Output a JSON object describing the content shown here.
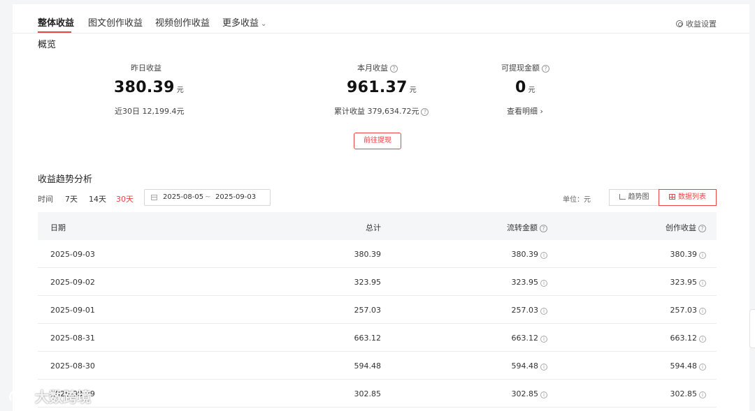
{
  "tabs": [
    {
      "label": "整体收益",
      "active": true
    },
    {
      "label": "图文创作收益",
      "active": false
    },
    {
      "label": "视频创作收益",
      "active": false
    },
    {
      "label": "更多收益",
      "active": false
    }
  ],
  "settings_label": "收益设置",
  "overview": {
    "title": "概览",
    "yesterday": {
      "label": "昨日收益",
      "value": "380.39",
      "unit": "元",
      "sub": "近30日 12,199.4元"
    },
    "month": {
      "label": "本月收益",
      "value": "961.37",
      "unit": "元",
      "sub": "累计收益 379,634.72元"
    },
    "withdrawable": {
      "label": "可提现金额",
      "value": "0",
      "unit": "元",
      "sub": "查看明细"
    },
    "withdraw_button": "前往提现"
  },
  "trend": {
    "title": "收益趋势分析",
    "time_label": "时间",
    "ranges": [
      {
        "label": "7天",
        "active": false
      },
      {
        "label": "14天",
        "active": false
      },
      {
        "label": "30天",
        "active": true
      }
    ],
    "date_start": "2025-08-05",
    "date_sep": "~",
    "date_end": "2025-09-03",
    "unit_label": "单位：元",
    "view_chart": "趋势图",
    "view_table": "数据列表"
  },
  "table": {
    "headers": {
      "date": "日期",
      "total": "总计",
      "flow": "流转金额",
      "create": "创作收益"
    },
    "rows": [
      {
        "date": "2025-09-03",
        "total": "380.39",
        "flow": "380.39",
        "create": "380.39"
      },
      {
        "date": "2025-09-02",
        "total": "323.95",
        "flow": "323.95",
        "create": "323.95"
      },
      {
        "date": "2025-09-01",
        "total": "257.03",
        "flow": "257.03",
        "create": "257.03"
      },
      {
        "date": "2025-08-31",
        "total": "663.12",
        "flow": "663.12",
        "create": "663.12"
      },
      {
        "date": "2025-08-30",
        "total": "594.48",
        "flow": "594.48",
        "create": "594.48"
      },
      {
        "date": "2025-08-29",
        "total": "302.85",
        "flow": "302.85",
        "create": "302.85"
      }
    ]
  },
  "watermark": "大数跨境",
  "colors": {
    "accent": "#e84545",
    "header_bg": "#f5f6f7"
  }
}
